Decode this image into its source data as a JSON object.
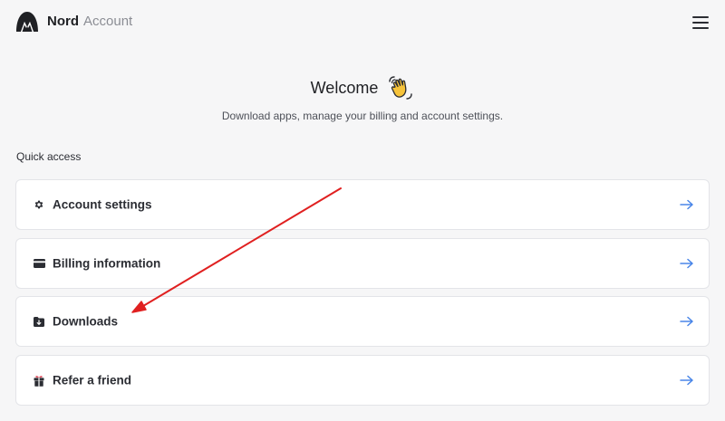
{
  "header": {
    "brand": "Nord",
    "product": "Account",
    "menu_icon": "hamburger-menu-icon"
  },
  "welcome": {
    "title": "Welcome",
    "emoji_icon": "waving-hand-icon",
    "subtitle": "Download apps, manage your billing and account settings."
  },
  "quick_access": {
    "label": "Quick access",
    "items": [
      {
        "label": "Account settings",
        "icon": "gear-icon"
      },
      {
        "label": "Billing information",
        "icon": "credit-card-icon"
      },
      {
        "label": "Downloads",
        "icon": "download-folder-icon"
      },
      {
        "label": "Refer a friend",
        "icon": "gift-icon"
      }
    ]
  },
  "colors": {
    "arrow": "#4a86e8",
    "annotation": "#e02020",
    "background": "#f6f6f7",
    "card": "#ffffff"
  }
}
